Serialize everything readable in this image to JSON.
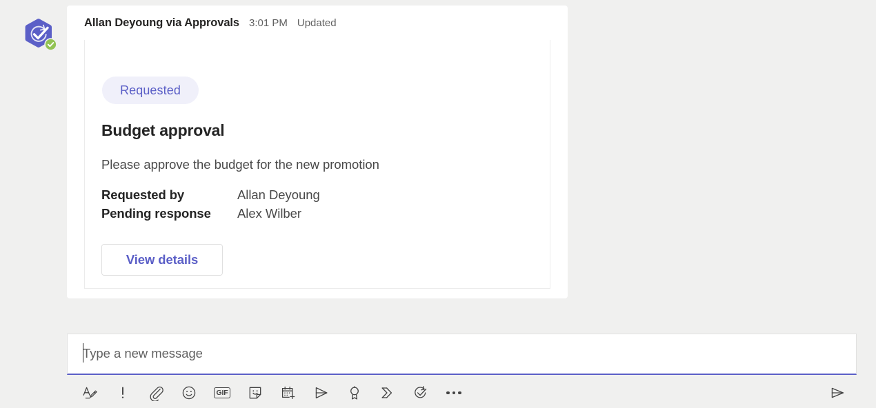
{
  "theme": {
    "page_background": "#f0f0ef",
    "accent_purple": "#5b5fc7",
    "badge_background": "#f0f0fa",
    "avatar_badge_green": "#92c353",
    "text_primary": "#242424",
    "text_secondary": "#616161"
  },
  "message": {
    "avatar_icon": "approvals-app-icon",
    "avatar_badge_icon": "check-badge-icon",
    "sender": "Allan Deyoung via Approvals",
    "time": "3:01 PM",
    "status": "Updated"
  },
  "card": {
    "status_badge": "Requested",
    "title": "Budget approval",
    "description": "Please approve the budget for the new promotion",
    "facts": [
      {
        "label": "Requested by",
        "value": "Allan Deyoung"
      },
      {
        "label": "Pending response",
        "value": "Alex Wilber"
      }
    ],
    "action_button": "View details"
  },
  "compose": {
    "placeholder": "Type a new message",
    "value": "",
    "toolbar": [
      {
        "name": "format-icon",
        "label": "Format"
      },
      {
        "name": "important-icon",
        "label": "Set delivery options"
      },
      {
        "name": "attach-icon",
        "label": "Attach"
      },
      {
        "name": "emoji-icon",
        "label": "Emoji"
      },
      {
        "name": "gif-icon",
        "label": "GIF"
      },
      {
        "name": "sticker-icon",
        "label": "Sticker"
      },
      {
        "name": "schedule-meeting-icon",
        "label": "Schedule a meeting"
      },
      {
        "name": "stream-icon",
        "label": "Stream"
      },
      {
        "name": "praise-icon",
        "label": "Praise"
      },
      {
        "name": "power-automate-icon",
        "label": "Power Automate"
      },
      {
        "name": "approvals-icon",
        "label": "Approvals"
      },
      {
        "name": "more-options-icon",
        "label": "More options"
      }
    ],
    "gif_label": "GIF",
    "send_label": "Send"
  }
}
